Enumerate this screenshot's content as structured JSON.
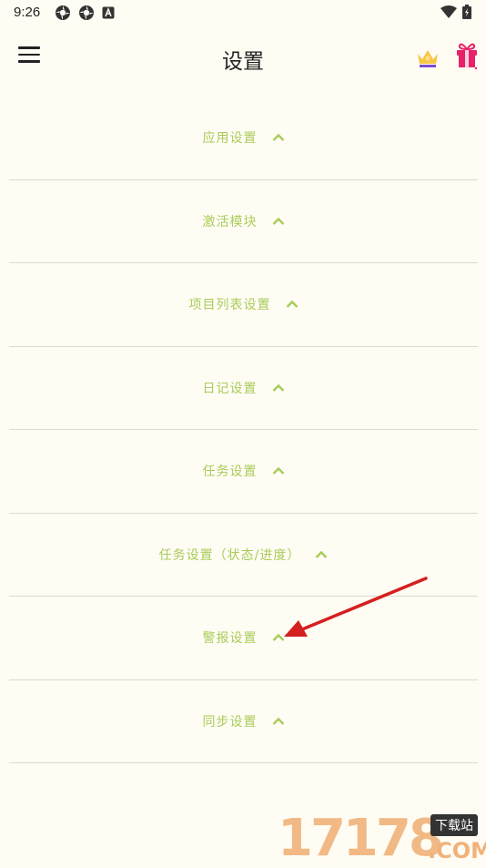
{
  "status_bar": {
    "time": "9:26"
  },
  "header": {
    "title": "设置"
  },
  "sections": [
    {
      "label": "应用设置"
    },
    {
      "label": "激活模块"
    },
    {
      "label": "项目列表设置"
    },
    {
      "label": "日记设置"
    },
    {
      "label": "任务设置"
    },
    {
      "label": "任务设置（状态/进度）"
    },
    {
      "label": "警报设置"
    },
    {
      "label": "同步设置"
    }
  ],
  "watermark": {
    "digits": "17178",
    "tag": "下载站",
    "com": ".COM"
  },
  "colors": {
    "accent": "#a8cc5a",
    "background": "#fffcf3",
    "divider": "#dcdad2",
    "annotation_arrow": "#d42020"
  }
}
